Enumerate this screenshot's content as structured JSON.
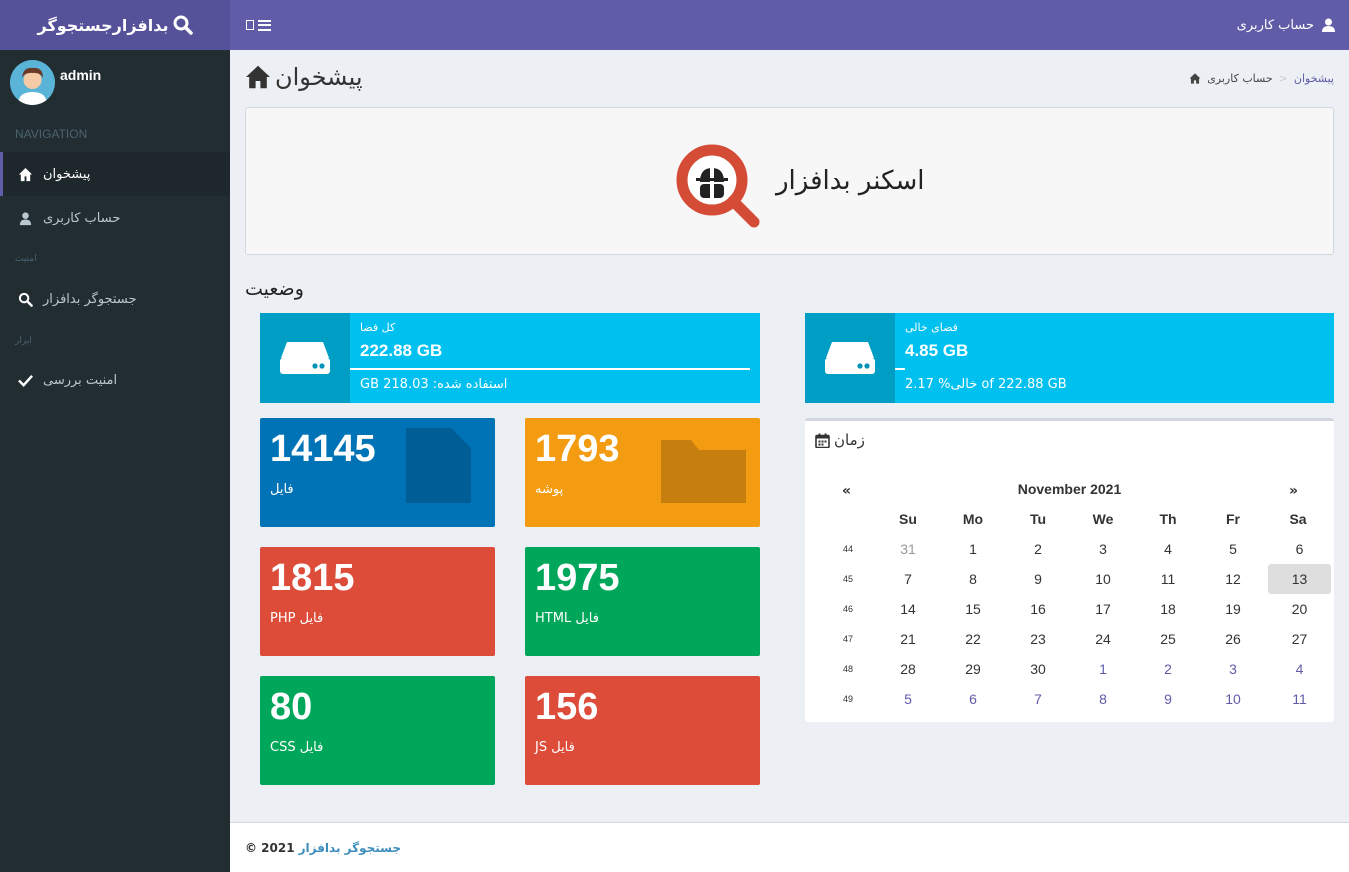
{
  "app": {
    "logo_text": "بدافزارجستجوگر"
  },
  "topbar": {
    "user_label": "حساب کاربری"
  },
  "sidebar": {
    "username": "admin",
    "header_nav": "NAVIGATION",
    "header_security": "امنیت",
    "header_tools": "ابزار",
    "items": [
      {
        "label": "پیشخوان"
      },
      {
        "label": "حساب کاربری"
      },
      {
        "label": "جستجوگر بدافزار"
      },
      {
        "label": "امنیت بررسی"
      }
    ]
  },
  "page": {
    "title": "پیشخوان",
    "breadcrumb": {
      "home": "حساب کاربری",
      "current": "پیشخوان"
    },
    "banner_title": "اسکنر بدافزار",
    "status_title": "وضعیت"
  },
  "info_boxes": {
    "total": {
      "label": "کل فضا",
      "value": "222.88 GB",
      "desc": "GB 218.03 :استفاده شده",
      "progress_percent": 100
    },
    "free": {
      "label": "فضای خالی",
      "value": "4.85 GB",
      "desc": "2.17 %خالی of 222.88 GB",
      "progress_percent": 2.17
    }
  },
  "stats": [
    {
      "value": "14145",
      "label": "فایل",
      "color": "#0073b7"
    },
    {
      "value": "1793",
      "label": "پوشه",
      "color": "#f39c12"
    },
    {
      "value": "1815",
      "label": "PHP فایل",
      "color": "#dd4b39"
    },
    {
      "value": "1975",
      "label": "HTML فایل",
      "color": "#00a65a"
    },
    {
      "value": "80",
      "label": "CSS فایل",
      "color": "#00a65a"
    },
    {
      "value": "156",
      "label": "JS فایل",
      "color": "#dd4b39"
    }
  ],
  "calendar": {
    "title": "زمان",
    "month": "November 2021",
    "prev": "«",
    "next": "»",
    "weekdays": [
      "Su",
      "Mo",
      "Tu",
      "We",
      "Th",
      "Fr",
      "Sa"
    ],
    "weeks": [
      {
        "wk": "44",
        "days": [
          "31",
          "1",
          "2",
          "3",
          "4",
          "5",
          "6"
        ]
      },
      {
        "wk": "45",
        "days": [
          "7",
          "8",
          "9",
          "10",
          "11",
          "12",
          "13"
        ]
      },
      {
        "wk": "46",
        "days": [
          "14",
          "15",
          "16",
          "17",
          "18",
          "19",
          "20"
        ]
      },
      {
        "wk": "47",
        "days": [
          "21",
          "22",
          "23",
          "24",
          "25",
          "26",
          "27"
        ]
      },
      {
        "wk": "48",
        "days": [
          "28",
          "29",
          "30",
          "1",
          "2",
          "3",
          "4"
        ]
      },
      {
        "wk": "49",
        "days": [
          "5",
          "6",
          "7",
          "8",
          "9",
          "10",
          "11"
        ]
      }
    ],
    "today": "13"
  },
  "footer": {
    "copyright": "© 2021",
    "brand": "جستجوگر بدافزار"
  },
  "colors": {
    "accent": "#605ca8",
    "info": "#00c0ef",
    "sidebar": "#222d32"
  }
}
